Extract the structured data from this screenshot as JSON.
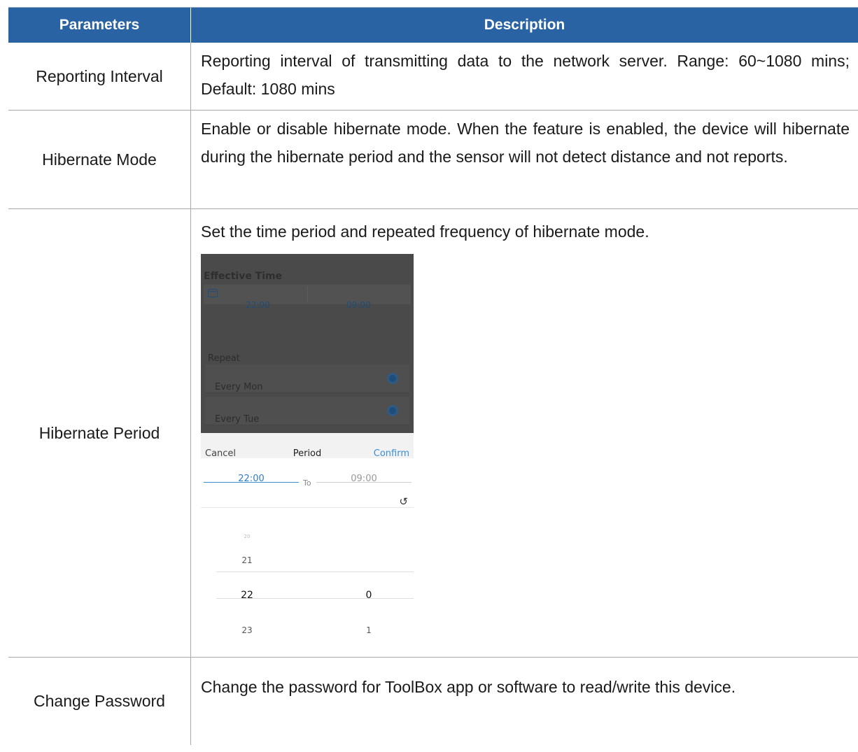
{
  "table": {
    "header": {
      "parameters": "Parameters",
      "description": "Description"
    },
    "rows": [
      {
        "param": "Reporting Interval",
        "desc": "Reporting interval of transmitting data to the network server. Range: 60~1080 mins; Default: 1080 mins"
      },
      {
        "param": "Hibernate Mode",
        "desc": "Enable or disable hibernate mode. When the feature is enabled, the device will hibernate during the hibernate period and the sensor will not detect distance and not reports."
      },
      {
        "param": "Hibernate Period",
        "desc": "Set the time period and repeated frequency of hibernate mode."
      },
      {
        "param": "Change Password",
        "desc": "Change the password for ToolBox app or software to read/write this device."
      }
    ]
  },
  "phone": {
    "effective_time_label": "Effective Time",
    "start_time": "22:00",
    "end_time": "09:00",
    "repeat_label": "Repeat",
    "days": [
      "Every Mon",
      "Every Tue"
    ],
    "dialog": {
      "cancel": "Cancel",
      "title": "Period",
      "confirm": "Confirm",
      "from_value": "22:00",
      "to_label": "To",
      "to_value": "09:00"
    },
    "picker": {
      "hours": [
        "21",
        "22",
        "23"
      ],
      "minutes": [
        "0",
        "1"
      ],
      "top_faded": "20"
    },
    "colors": {
      "header_bg": "#2a63a4",
      "accent": "#3a8ed0"
    }
  }
}
